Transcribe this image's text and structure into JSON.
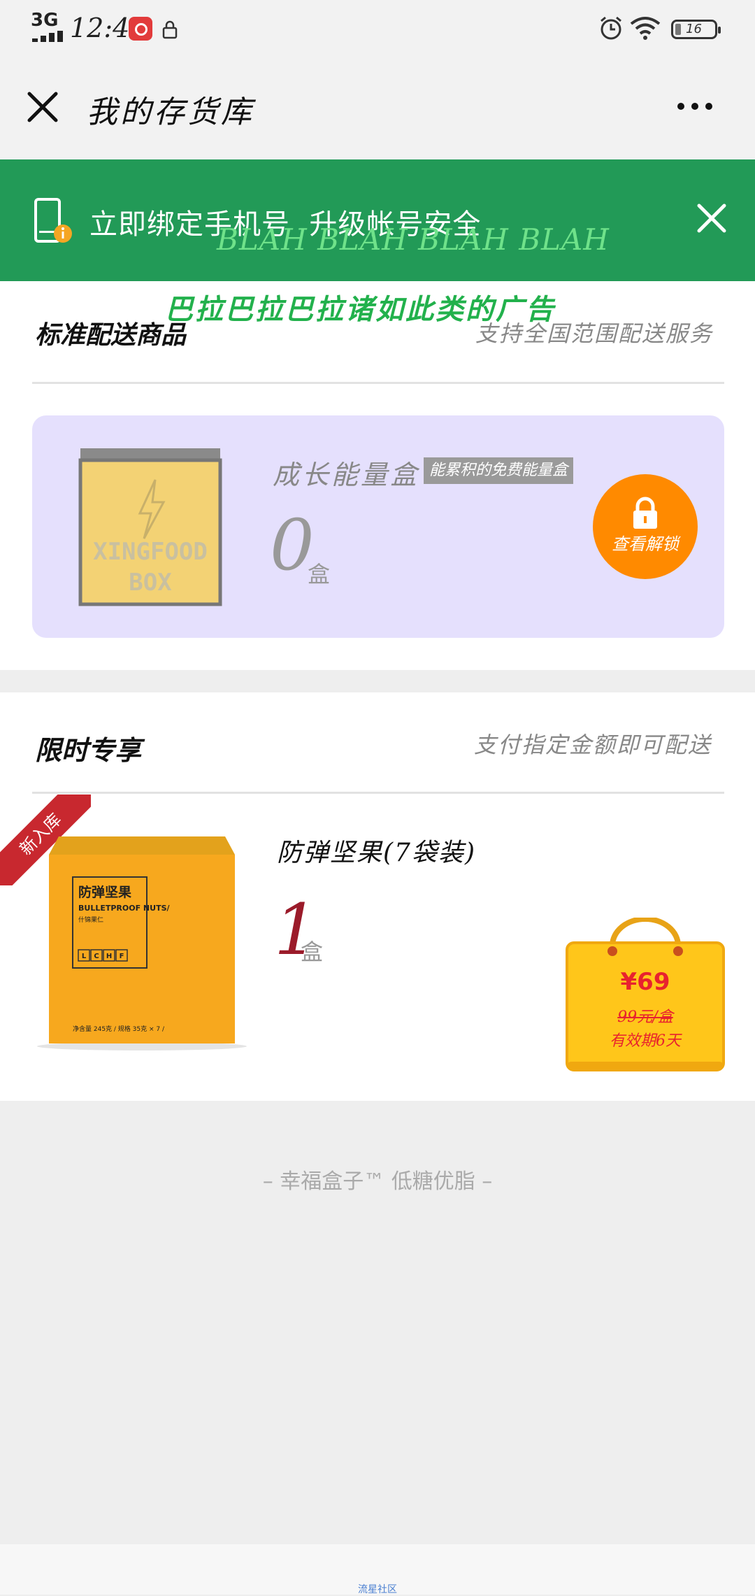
{
  "status_bar": {
    "network": "3G",
    "time": "12:46",
    "battery": "16"
  },
  "nav": {
    "title": "我的存货库"
  },
  "banner": {
    "text": "立即绑定手机号  升级帐号安全",
    "overlay_text": "BLAH BLAH BLAH BLAH"
  },
  "ad_overlay": "巴拉巴拉巴拉诸如此类的广告",
  "section_standard": {
    "title": "标准配送商品",
    "subtitle": "支持全国范围配送服务",
    "item": {
      "box_label": "XINGFOOD BOX",
      "name": "成长能量盒",
      "tag": "能累积的免费能量盒",
      "count": "0",
      "unit": "盒",
      "action_label": "查看解锁"
    }
  },
  "section_limited": {
    "title": "限时专享",
    "subtitle": "支付指定金额即可配送",
    "ribbon": "新入库",
    "item": {
      "name": "防弹坚果(7袋装)",
      "count": "1",
      "unit": "盒",
      "package_title": "防弹坚果",
      "package_sub": "BULLETPROOF NUTS/",
      "package_cn": "什锦果仁",
      "package_letters": [
        "L",
        "C",
        "H",
        "F"
      ],
      "package_footer": "净含量 245克 / 规格 35克 × 7 /",
      "price": "¥69",
      "original_price": "99元/盒",
      "validity": "有效期6天"
    }
  },
  "footer": {
    "slogan": "– 幸福盒子™ 低糖优脂 –",
    "bottom_link": "流星社区"
  },
  "colors": {
    "banner_green": "#229a57",
    "unlock_orange": "#ff8a00",
    "bag_yellow": "#ffc61a",
    "price_red": "#e8222e",
    "ribbon_red": "#c8282f",
    "energy_card_bg": "#e5e0fd"
  }
}
